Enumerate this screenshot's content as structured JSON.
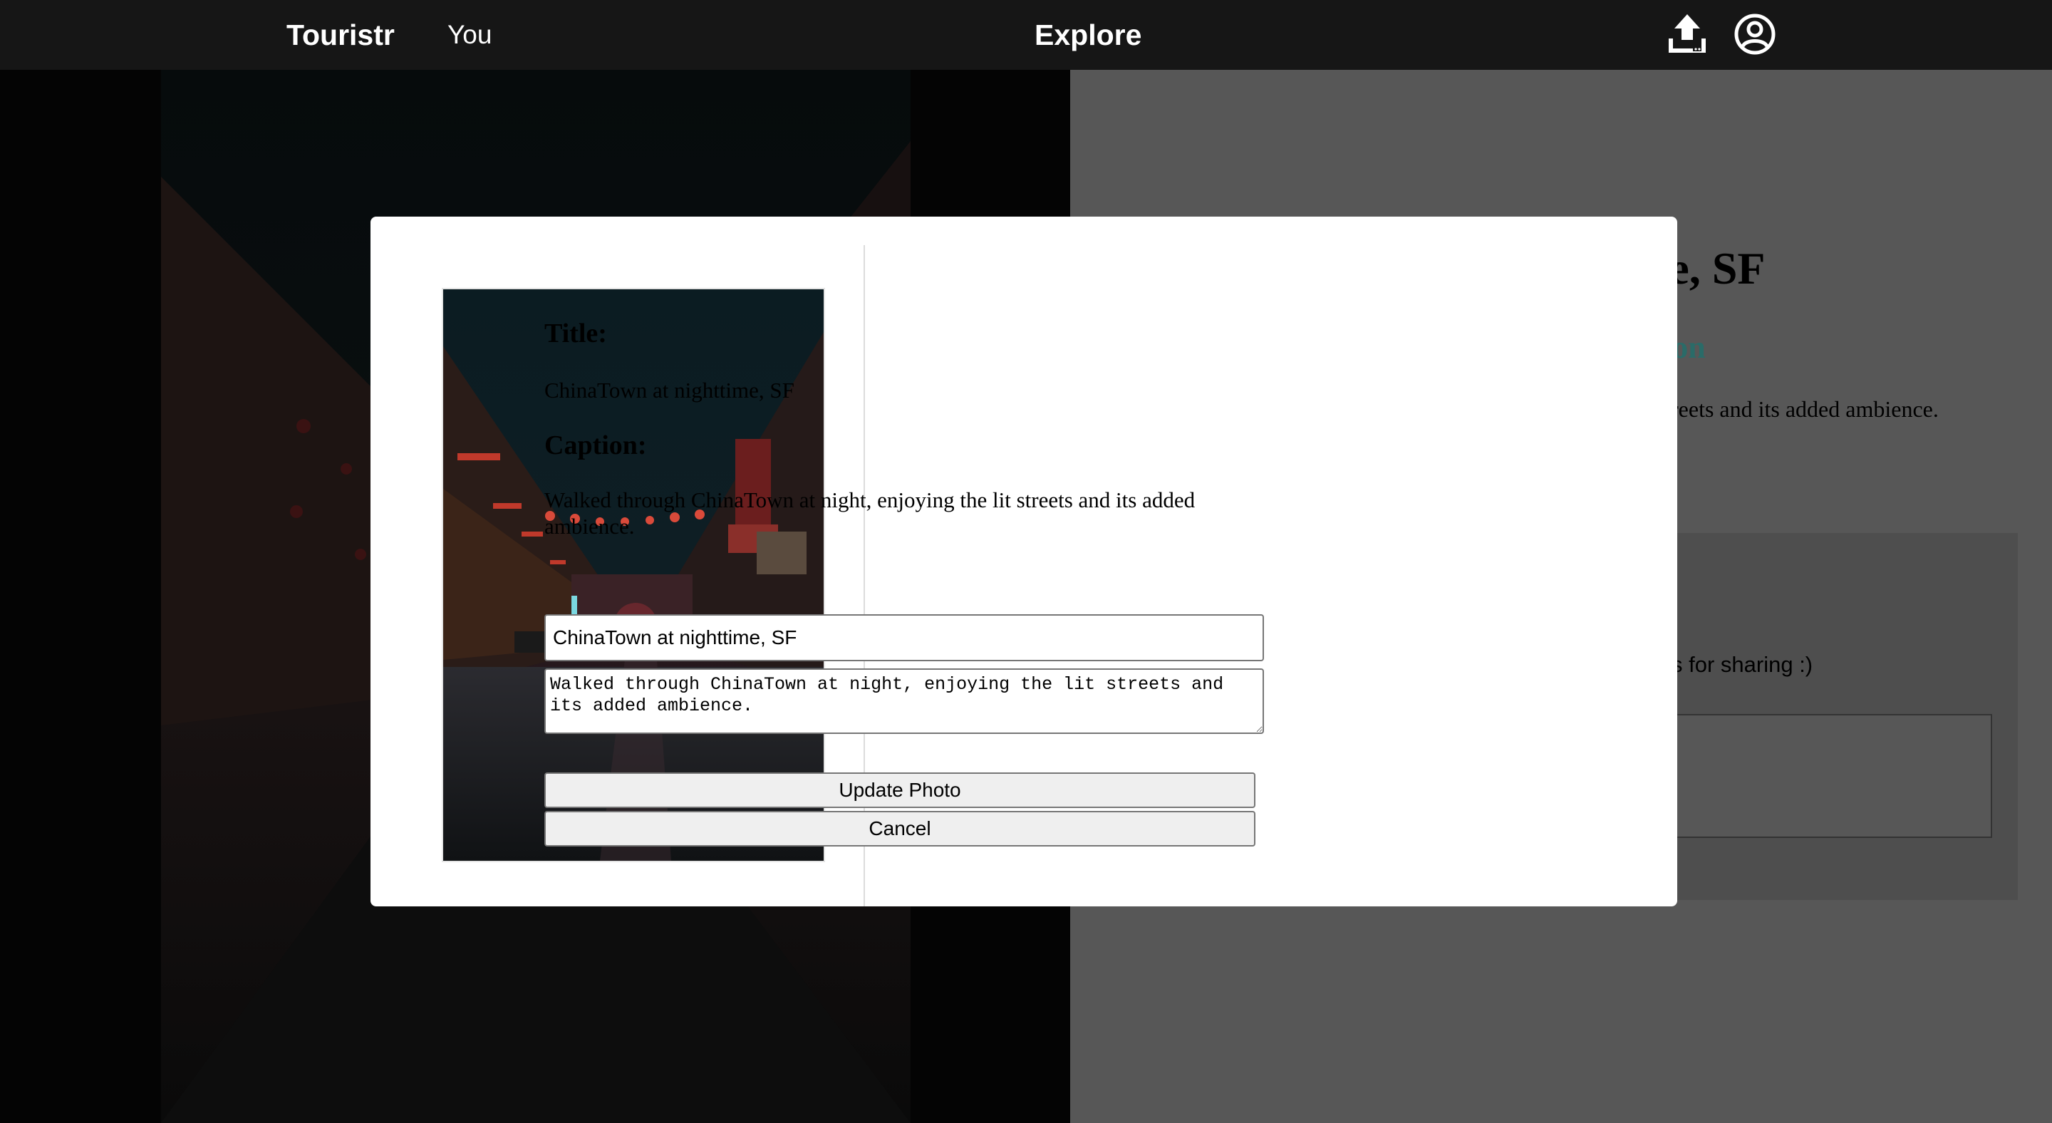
{
  "navbar": {
    "brand": "Touristr",
    "you_link": "You",
    "explore_link": "Explore",
    "upload_icon": "upload-icon",
    "account_icon": "user-circle-icon"
  },
  "background": {
    "photo_title_partial": "time, SF",
    "subtitle_partial": "ion",
    "caption_partial": "reets and its added ambience.",
    "comment_prompt_partial": "s for sharing :)"
  },
  "modal": {
    "title_label": "Title:",
    "title_value": "ChinaTown at nighttime, SF",
    "caption_label": "Caption:",
    "caption_value": "Walked through ChinaTown at night, enjoying the lit streets and its added ambience.",
    "title_input_value": "ChinaTown at nighttime, SF",
    "caption_input_value": "Walked through ChinaTown at night, enjoying the lit streets and its added ambience.",
    "update_button": "Update Photo",
    "cancel_button": "Cancel"
  },
  "colors": {
    "navbar": "#161616",
    "subtitle_accent": "#2a6b68",
    "button_bg": "#efefef"
  }
}
